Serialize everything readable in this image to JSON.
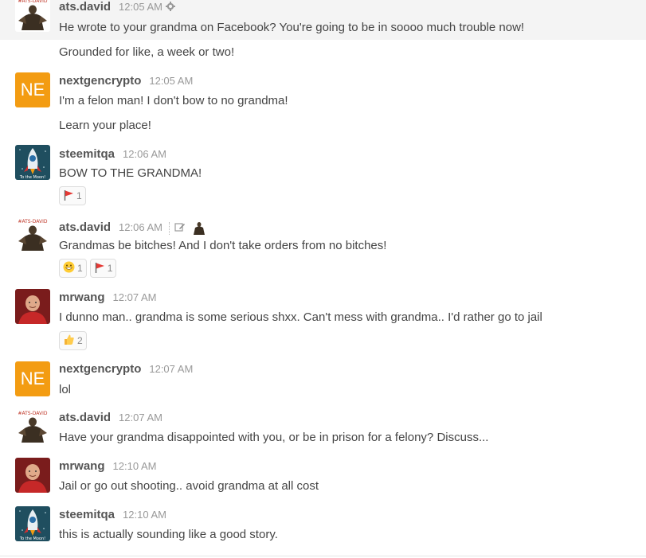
{
  "messages": [
    {
      "user": "ats.david",
      "time": "12:05 AM",
      "lines": [
        "He wrote to your grandma on Facebook? You're going to be in soooo much trouble now!",
        "Grounded for like, a week or two!"
      ]
    },
    {
      "user": "nextgencrypto",
      "avatar_text": "NE",
      "time": "12:05 AM",
      "lines": [
        "I'm a felon man! I don't bow to no grandma!",
        "Learn your place!"
      ]
    },
    {
      "user": "steemitqa",
      "time": "12:06 AM",
      "lines": [
        "BOW TO THE GRANDMA!"
      ],
      "reactions": [
        {
          "icon": "red-flag-icon",
          "count": "1"
        }
      ]
    },
    {
      "user": "ats.david",
      "time": "12:06 AM",
      "lines": [
        "Grandmas be bitches! And I don't take orders from no bitches!"
      ],
      "reactions": [
        {
          "icon": "grin-emoji-icon",
          "count": "1"
        },
        {
          "icon": "red-flag-icon",
          "count": "1"
        }
      ]
    },
    {
      "user": "mrwang",
      "time": "12:07 AM",
      "lines": [
        "I dunno man.. grandma is some serious shxx. Can't mess with grandma.. I'd rather go to jail"
      ],
      "reactions": [
        {
          "icon": "thumbs-up-icon",
          "count": "2"
        }
      ]
    },
    {
      "user": "nextgencrypto",
      "avatar_text": "NE",
      "time": "12:07 AM",
      "lines": [
        "lol"
      ]
    },
    {
      "user": "ats.david",
      "time": "12:07 AM",
      "lines": [
        "Have your grandma disappointed with you, or be in prison for a felony? Discuss..."
      ]
    },
    {
      "user": "mrwang",
      "time": "12:10 AM",
      "lines": [
        "Jail or go out shooting.. avoid grandma at all cost"
      ]
    },
    {
      "user": "steemitqa",
      "time": "12:10 AM",
      "lines": [
        "this is actually sounding like a good story."
      ]
    }
  ],
  "avatar_labels": {
    "ats_david": "#ATS-DAVID",
    "steemitqa_caption": "To the Moon!"
  },
  "colors": {
    "ne_avatar": "#f39c12",
    "highlight_row": "#f4f4f4",
    "red_flag": "#e53935",
    "mrwang_shirt": "#c62828"
  }
}
